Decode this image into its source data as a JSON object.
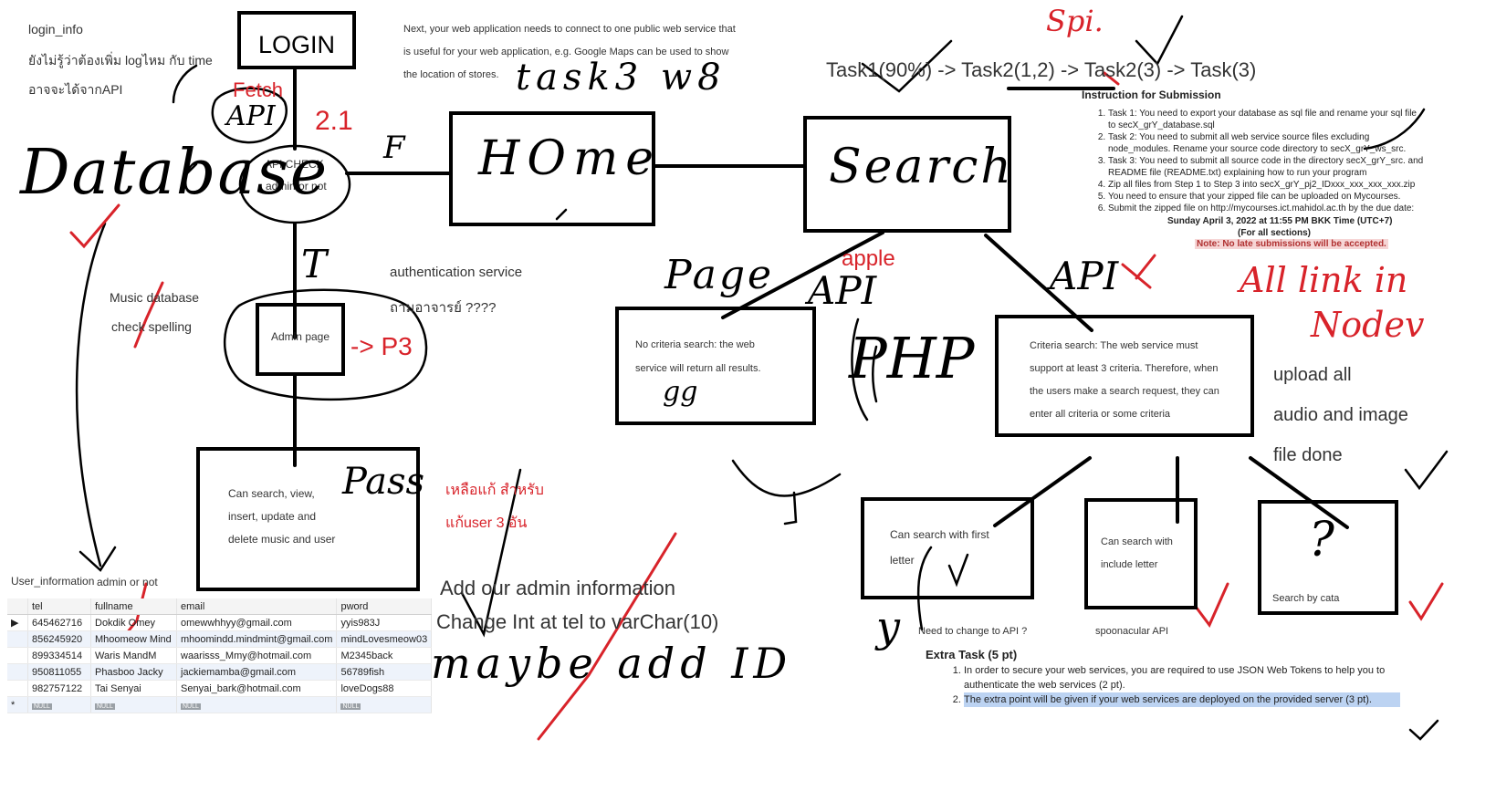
{
  "notes": {
    "login_info": "login_info",
    "thai_log_line": "ยังไม่รู้ว่าต้องเพิ่ม logไหม กับ time",
    "thai_api_line": "อาจจะได้จากAPI",
    "login": "LOGIN",
    "fetch": "Fetch",
    "api_small": "API",
    "step_2_1": "2.1",
    "api_check": "API CHECK",
    "admin_or_not": "admin or not",
    "f_label": "F",
    "t_label": "T",
    "database": "Database",
    "music_db": "Music database",
    "check_spelling": "check spelling",
    "admin_page": "Admin page",
    "p3": "-> P3",
    "auth_service": "authentication service",
    "ask_teacher": "ถามอาจารย์ ????",
    "can_search_view": "Can search, view,",
    "insert_update": "insert, update and",
    "delete_music": "delete music  and user",
    "pass": "Pass",
    "thai_fix_1": "เหลือแก้ สำหรับ",
    "thai_fix_2": "แก้user 3 อัน",
    "add_admin": "Add our admin information",
    "change_int": "Change Int at tel to varChar(10)",
    "maybe_add_id": "maybe add ID",
    "user_information": "User_information",
    "admin_or_not_2": "admin or not",
    "next_web_1": "Next, your web application needs to connect to one public web service that",
    "next_web_2": "is useful for your web application, e.g. Google Maps can be used to show",
    "next_web_3": "the location of stores.",
    "task3_w8": "task3 w8",
    "home": "HOme",
    "search": "Search",
    "tasks_line": "Task1(90%) -> Task2(1,2) -> Task2(3) -> Task(3)",
    "spi": "Spi.",
    "page": "Page",
    "apple": "apple",
    "api_big": "API",
    "api_right": "API",
    "php": "PHP",
    "no_criteria_1": "No criteria search: the web",
    "no_criteria_2": "service will return all results.",
    "gg": "gg",
    "criteria_1": "Criteria search: The web service must",
    "criteria_2": "support at least 3 criteria. Therefore, when",
    "criteria_3": "the users make a search request, they can",
    "criteria_4": "enter all criteria or some criteria",
    "all_link_1": "All link in",
    "all_link_2": "Nodev",
    "upload_1": "upload all",
    "upload_2": "audio and image",
    "upload_3": "file done",
    "first_letter_1": "Can search with first",
    "first_letter_2": "letter",
    "include_1": "Can search with",
    "include_2": "include letter",
    "question": "?",
    "search_cata": "Search by cata",
    "need_change_api": "Need to change to API ?",
    "spoonacular": "spoonacular API",
    "y_mark": "y"
  },
  "instructions": {
    "title": "Instruction for Submission",
    "items": [
      "Task 1: You need to export your database as sql file and rename your sql file to secX_grY_database.sql",
      "Task 2: You need to submit all web service source files excluding node_modules. Rename your source code directory to secX_grY_ws_src.",
      "Task 3: You need to submit all source code in the directory secX_grY_src. and README file (README.txt) explaining how to run your program",
      "Zip all files from Step 1 to Step 3 into secX_grY_pj2_IDxxx_xxx_xxx_xxx.zip",
      "You need to ensure that your zipped file can be uploaded on Mycourses.",
      "Submit the zipped file on http://mycourses.ict.mahidol.ac.th by the due date:"
    ],
    "due": "Sunday April 3, 2022 at 11:55 PM BKK Time (UTC+7)",
    "all_sections": "(For all sections)",
    "note": "Note: No late submissions will be accepted."
  },
  "extra_task": {
    "title": "Extra Task (5 pt)",
    "items": [
      "In order to secure your web services, you are required to use JSON Web Tokens to help you to authenticate the web services (2 pt).",
      "The extra point will be given if your web services are deployed on the provided server (3 pt)."
    ]
  },
  "user_table": {
    "columns": [
      "tel",
      "fullname",
      "email",
      "pword"
    ],
    "rows": [
      [
        "645462716",
        "Dokdik Omey",
        "omewwhhyy@gmail.com",
        "yyis983J"
      ],
      [
        "856245920",
        "Mhoomeow Mind",
        "mhoomindd.mindmint@gmail.com",
        "mindLovesmeow03"
      ],
      [
        "899334514",
        "Waris MandM",
        "waarisss_Mmy@hotmail.com",
        "M2345back"
      ],
      [
        "950811055",
        "Phasboo Jacky",
        "jackiemamba@gmail.com",
        "56789fish"
      ],
      [
        "982757122",
        "Tai Senyai",
        "Senyai_bark@hotmail.com",
        "loveDogs88"
      ]
    ],
    "null_label": "NULL",
    "new_row_marker": "*",
    "current_row_marker": "▶"
  },
  "colors": {
    "ink": "#000000",
    "red": "#d8232a",
    "highlight": "#bcd3f2",
    "note_bg": "#f6d5d5"
  }
}
